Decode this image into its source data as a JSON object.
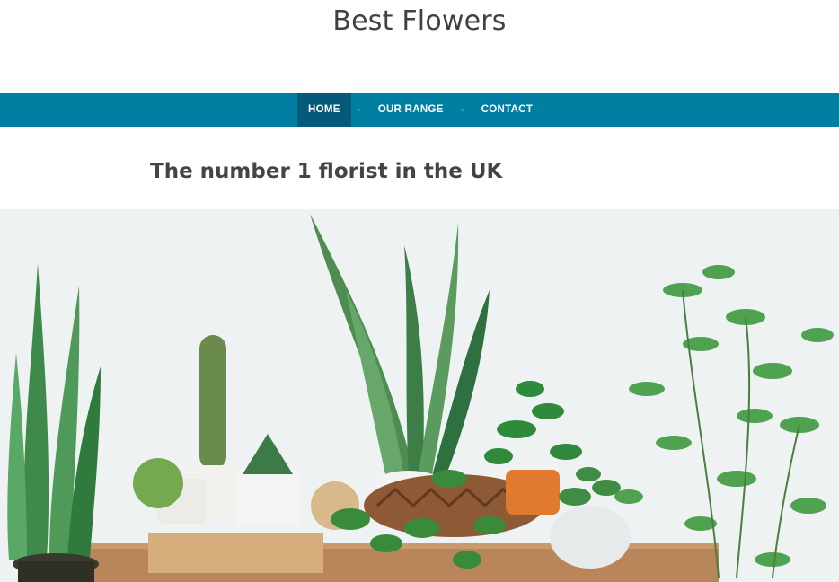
{
  "site": {
    "title": "Best Flowers"
  },
  "nav": {
    "items": [
      {
        "label": "HOME",
        "active": true
      },
      {
        "label": "OUR RANGE",
        "active": false
      },
      {
        "label": "CONTACT",
        "active": false
      }
    ]
  },
  "main": {
    "tagline": "The number 1 florist in the UK"
  },
  "colors": {
    "nav_bg": "#017fa3",
    "nav_active": "#045a78",
    "text": "#404040"
  },
  "hero": {
    "image": "houseplants-on-wooden-table"
  }
}
